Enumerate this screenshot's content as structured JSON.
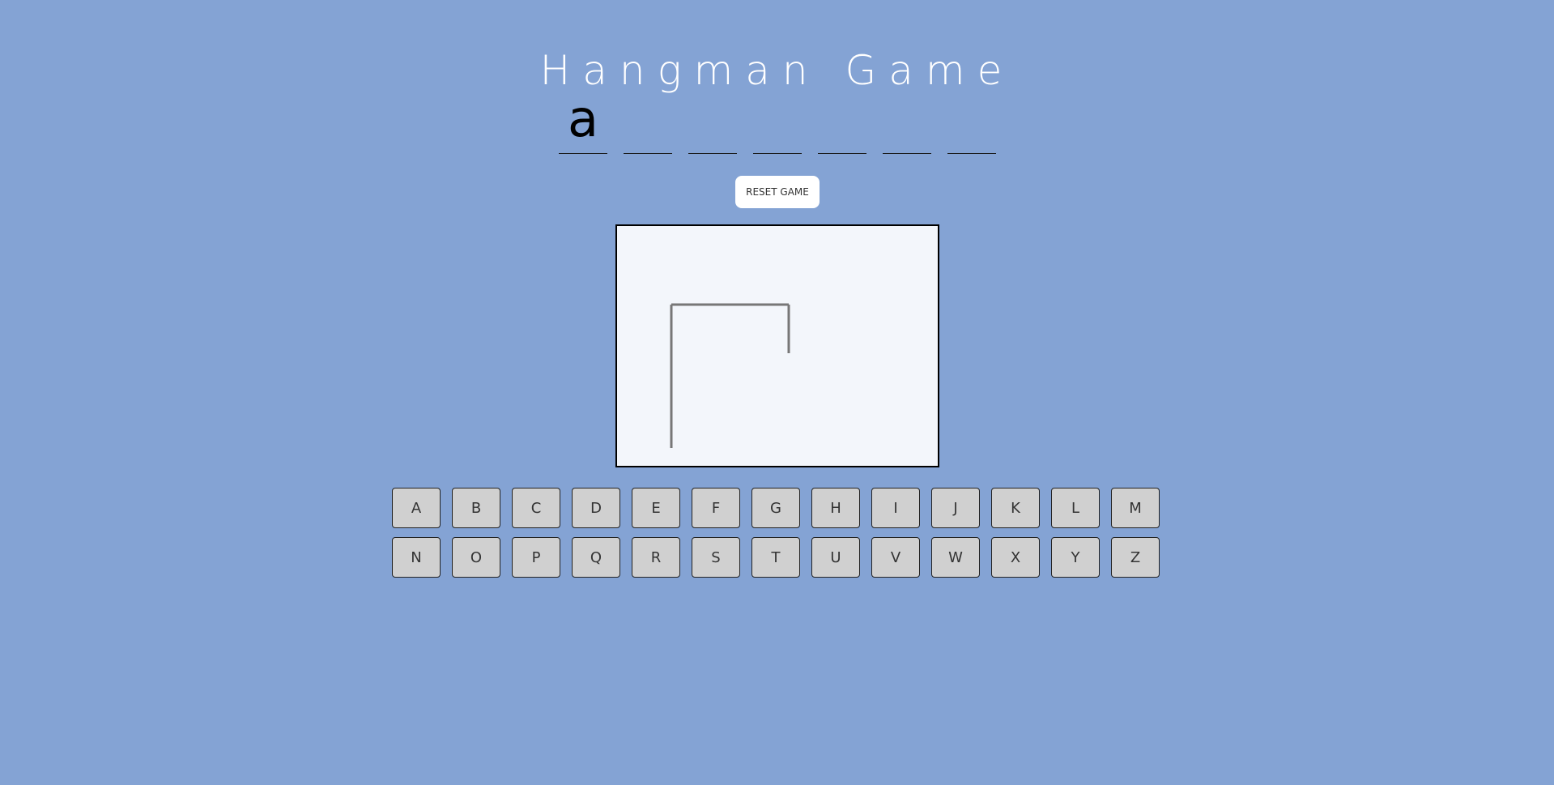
{
  "title": "Hangman Game",
  "word_slots": [
    "a",
    "",
    "",
    "",
    "",
    "",
    ""
  ],
  "reset_label": "RESET GAME",
  "keyboard": {
    "row1": [
      "A",
      "B",
      "C",
      "D",
      "E",
      "F",
      "G",
      "H",
      "I",
      "J",
      "K",
      "L",
      "M"
    ],
    "row2": [
      "N",
      "O",
      "P",
      "Q",
      "R",
      "S",
      "T",
      "U",
      "V",
      "W",
      "X",
      "Y",
      "Z"
    ]
  },
  "colors": {
    "background": "#84a3d4",
    "board": "#f3f6fb",
    "key": "#d0d0d0",
    "gallows": "#777777"
  }
}
